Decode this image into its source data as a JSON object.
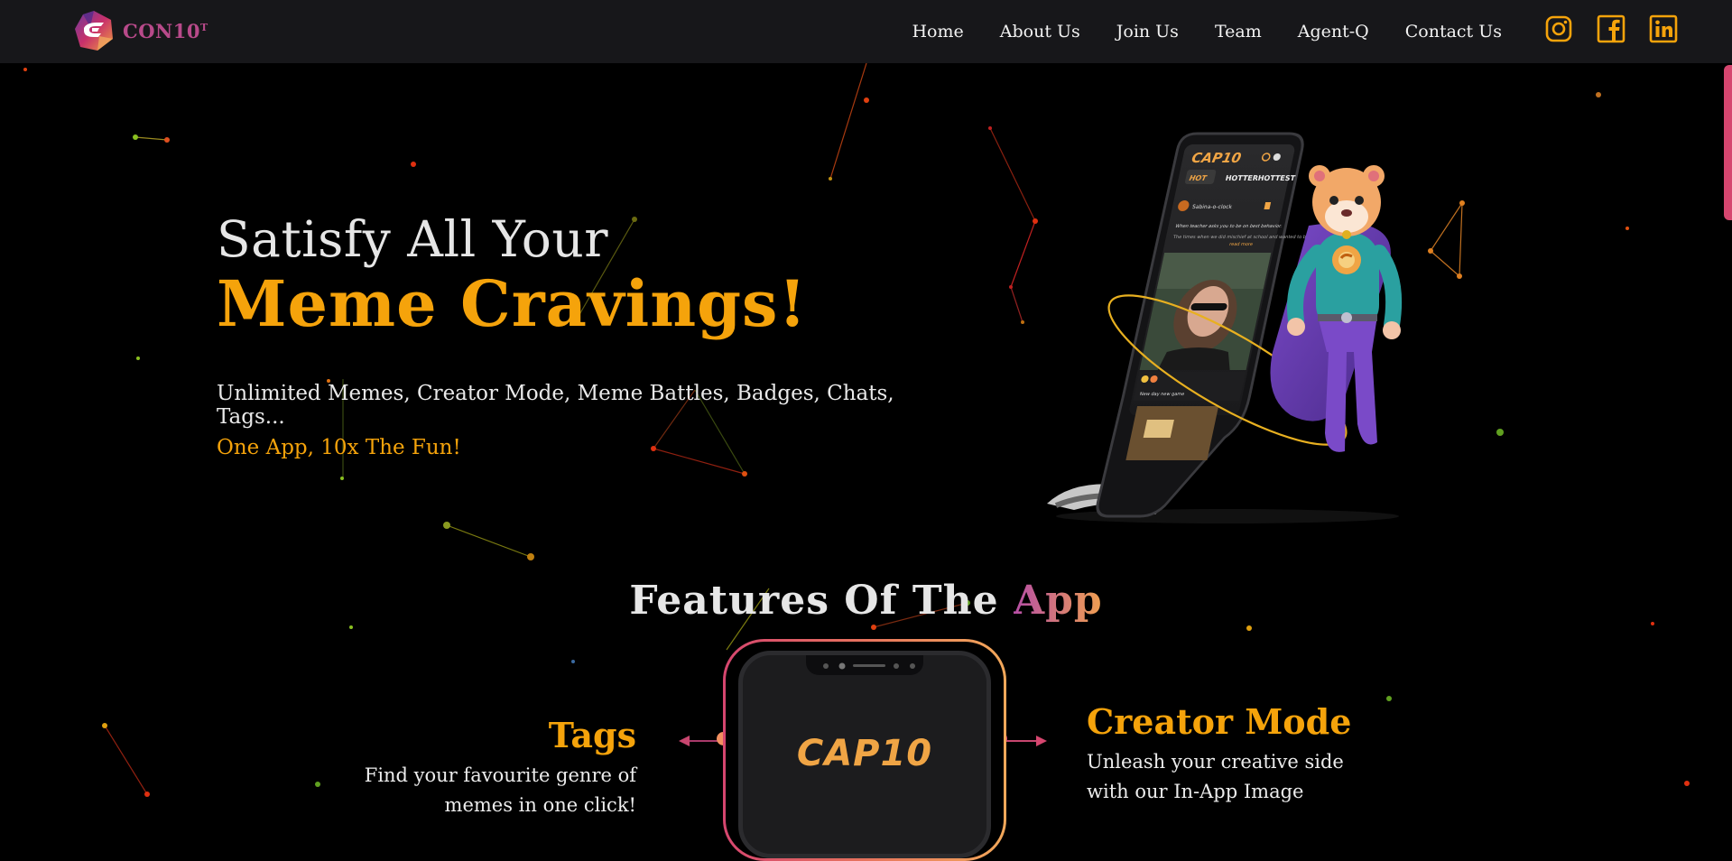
{
  "brand": {
    "name": "CON10",
    "superscript": "T"
  },
  "nav": {
    "items": [
      {
        "label": "Home"
      },
      {
        "label": "About Us"
      },
      {
        "label": "Join Us"
      },
      {
        "label": "Team"
      },
      {
        "label": "Agent-Q"
      },
      {
        "label": "Contact Us"
      }
    ],
    "socials": [
      "instagram-icon",
      "facebook-icon",
      "linkedin-icon"
    ]
  },
  "hero": {
    "line1": "Satisfy All Your",
    "line2": "Meme Cravings!",
    "sub1": "Unlimited Memes, Creator Mode, Meme Battles, Badges, Chats, Tags...",
    "sub2": "One App, 10x The Fun!"
  },
  "features": {
    "title_main": "Features Of The",
    "title_accent": "App",
    "phone_logo": "CAP10",
    "left": {
      "title": "Tags",
      "desc": "Find your favourite genre of memes in one click!"
    },
    "right": {
      "title": "Creator Mode",
      "desc": "Unleash your creative side with our In-App Image"
    }
  },
  "mockup": {
    "app_name": "CAP10",
    "tabs": [
      "HOT",
      "HOTTER",
      "HOTTEST"
    ],
    "post_user": "Sabina-o-clock",
    "post_caption": "When teacher asks you to be on best behavior.",
    "post_text": "The times when we did mischief at school and wanted to be caught...",
    "read_more": "read more",
    "second_caption": "New day new game"
  },
  "colors": {
    "accent": "#f5a30b",
    "brand": "#b84a8a",
    "navbar_bg": "#17171a",
    "background": "#000000",
    "gradient_start": "#d6466f",
    "gradient_end": "#f2a85a"
  }
}
